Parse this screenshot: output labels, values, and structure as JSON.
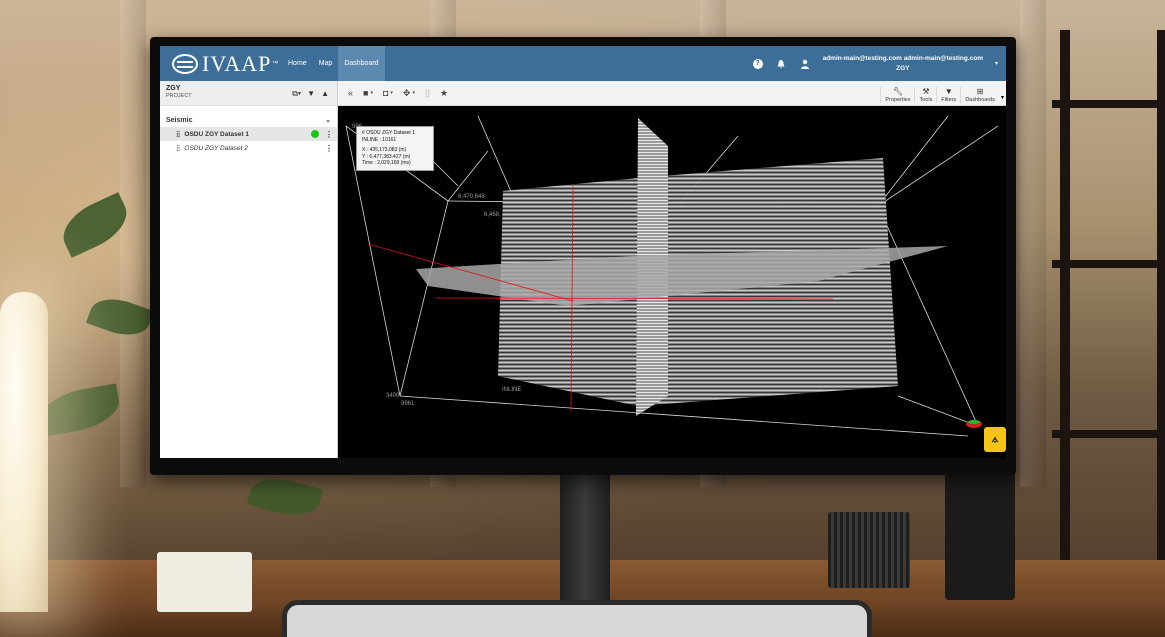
{
  "app": {
    "logo_text": "IVAAP",
    "logo_tm": "™",
    "nav": [
      "Home",
      "Map",
      "Dashboard"
    ],
    "active_nav": "Dashboard",
    "user_email_line": "admin-main@testing.com admin-main@testing.com",
    "user_project": "ZGY"
  },
  "left_panel": {
    "project_name": "ZGY",
    "project_sub": "PROJECT",
    "section_label": "Seismic",
    "datasets": [
      {
        "label": "OSDU ZGY Dataset 1",
        "selected": true,
        "status_color": "#17c617"
      },
      {
        "label": "OSDU ZGY Dataset 2",
        "selected": false
      }
    ]
  },
  "toolbar": {
    "buttons": [
      {
        "label": "Properties",
        "icon": "wrench-icon"
      },
      {
        "label": "Tools",
        "icon": "tools-icon"
      },
      {
        "label": "Filters",
        "icon": "filter-icon"
      },
      {
        "label": "Dashboards",
        "icon": "grid-icon"
      }
    ]
  },
  "viewer": {
    "tooltip": {
      "title": "# OSDU ZGY Dataset 1",
      "inline": "INLINE : 10161",
      "x": "X : 435,173.083 (m)",
      "y": "Y : 6,477,383.427 (m)",
      "time": "Time : 2,029,169 (ms)"
    },
    "axis_labels": {
      "inline": "INLINE",
      "v1": "3400",
      "v2": "9961",
      "n1": "6,470,648",
      "n2": "6,468,",
      "n3": "996"
    }
  },
  "colors": {
    "header": "#3d6e98",
    "active_tab": "#5b89b0",
    "fab": "#f6c416",
    "status_ok": "#17c617"
  }
}
